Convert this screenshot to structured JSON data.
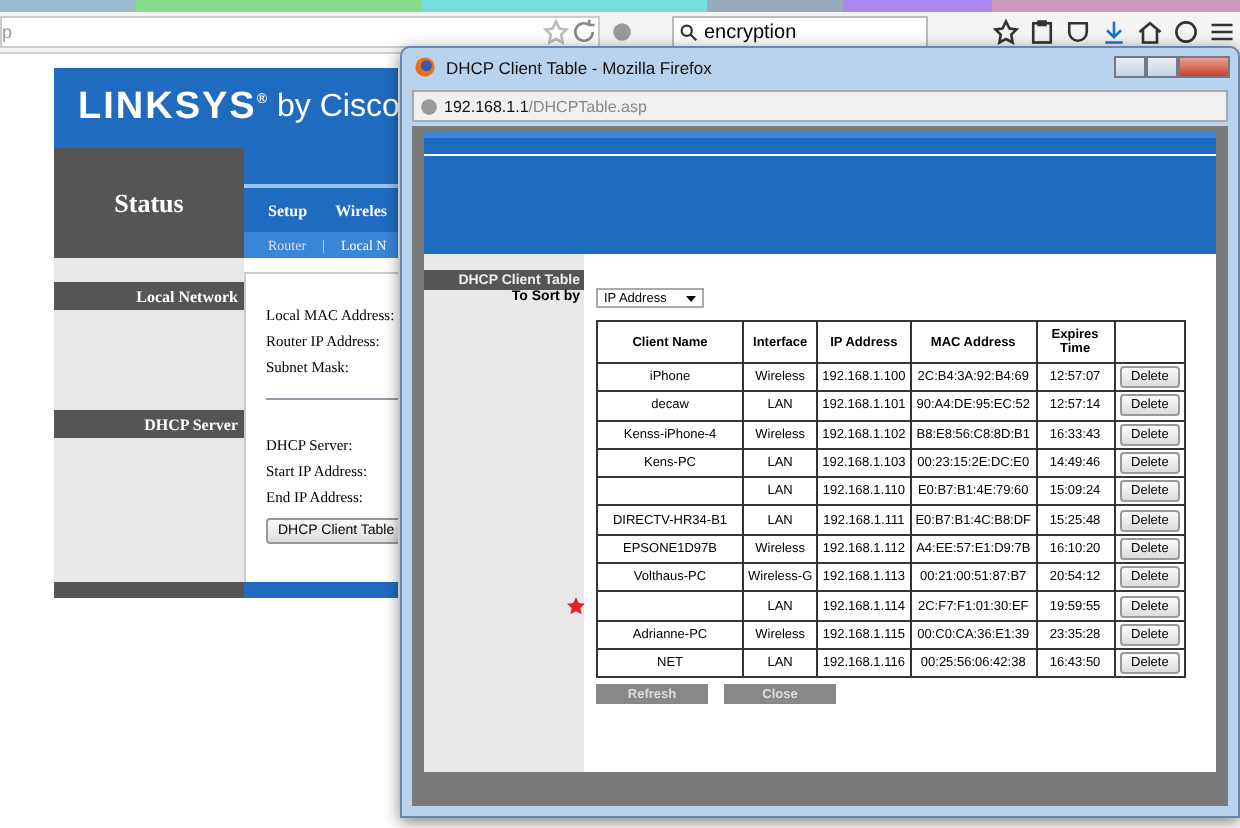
{
  "browser": {
    "address": "p",
    "search": "encryption"
  },
  "router_page": {
    "logo": "LINKSYS",
    "logo_mark": "®",
    "logo_suffix": "by Cisco",
    "section": "Status",
    "nav": [
      "Setup",
      "Wireles"
    ],
    "subnav": [
      "Router",
      "Local N"
    ],
    "subnav_separator": "|",
    "sections": [
      {
        "title": "Local Network",
        "fields": [
          "Local MAC Address:",
          "Router IP Address:",
          "Subnet Mask:"
        ]
      },
      {
        "title": "DHCP Server",
        "fields": [
          "DHCP Server:",
          "Start IP Address:",
          "End IP Address:"
        ],
        "button": "DHCP Client Table"
      }
    ]
  },
  "popup": {
    "title": "DHCP Client Table - Mozilla Firefox",
    "url_host": "192.168.1.1",
    "url_path": "/DHCPTable.asp",
    "section_title": "DHCP Client Table",
    "sort_label": "To Sort by",
    "sort_value": "IP Address",
    "columns": [
      "Client Name",
      "Interface",
      "IP Address",
      "MAC Address",
      "Expires Time"
    ],
    "rows": [
      {
        "name": "iPhone",
        "interface": "Wireless",
        "ip": "192.168.1.100",
        "mac": "2C:B4:3A:92:B4:69",
        "expires": "12:57:07",
        "action": "Delete",
        "starred": false
      },
      {
        "name": "decaw",
        "interface": "LAN",
        "ip": "192.168.1.101",
        "mac": "90:A4:DE:95:EC:52",
        "expires": "12:57:14",
        "action": "Delete",
        "starred": false
      },
      {
        "name": "Kenss-iPhone-4",
        "interface": "Wireless",
        "ip": "192.168.1.102",
        "mac": "B8:E8:56:C8:8D:B1",
        "expires": "16:33:43",
        "action": "Delete",
        "starred": false
      },
      {
        "name": "Kens-PC",
        "interface": "LAN",
        "ip": "192.168.1.103",
        "mac": "00:23:15:2E:DC:E0",
        "expires": "14:49:46",
        "action": "Delete",
        "starred": false
      },
      {
        "interface": "LAN",
        "ip": "192.168.1.110",
        "mac": "E0:B7:B1:4E:79:60",
        "expires": "15:09:24",
        "action": "Delete",
        "starred": false
      },
      {
        "name": "DIRECTV-HR34-B1",
        "interface": "LAN",
        "ip": "192.168.1.111",
        "mac": "E0:B7:B1:4C:B8:DF",
        "expires": "15:25:48",
        "action": "Delete",
        "starred": false
      },
      {
        "name": "EPSONE1D97B",
        "interface": "Wireless",
        "ip": "192.168.1.112",
        "mac": "A4:EE:57:E1:D9:7B",
        "expires": "16:10:20",
        "action": "Delete",
        "starred": false
      },
      {
        "name": "Volthaus-PC",
        "interface": "Wireless-G",
        "ip": "192.168.1.113",
        "mac": "00:21:00:51:87:B7",
        "expires": "20:54:12",
        "action": "Delete",
        "starred": false
      },
      {
        "interface": "LAN",
        "ip": "192.168.1.114",
        "mac": "2C:F7:F1:01:30:EF",
        "expires": "19:59:55",
        "action": "Delete",
        "starred": true
      },
      {
        "name": "Adrianne-PC",
        "interface": "Wireless",
        "ip": "192.168.1.115",
        "mac": "00:C0:CA:36:E1:39",
        "expires": "23:35:28",
        "action": "Delete",
        "starred": false
      },
      {
        "name": "NET",
        "interface": "LAN",
        "ip": "192.168.1.116",
        "mac": "00:25:56:06:42:38",
        "expires": "16:43:50",
        "action": "Delete",
        "starred": false
      }
    ],
    "buttons": [
      "Refresh",
      "Close"
    ]
  }
}
